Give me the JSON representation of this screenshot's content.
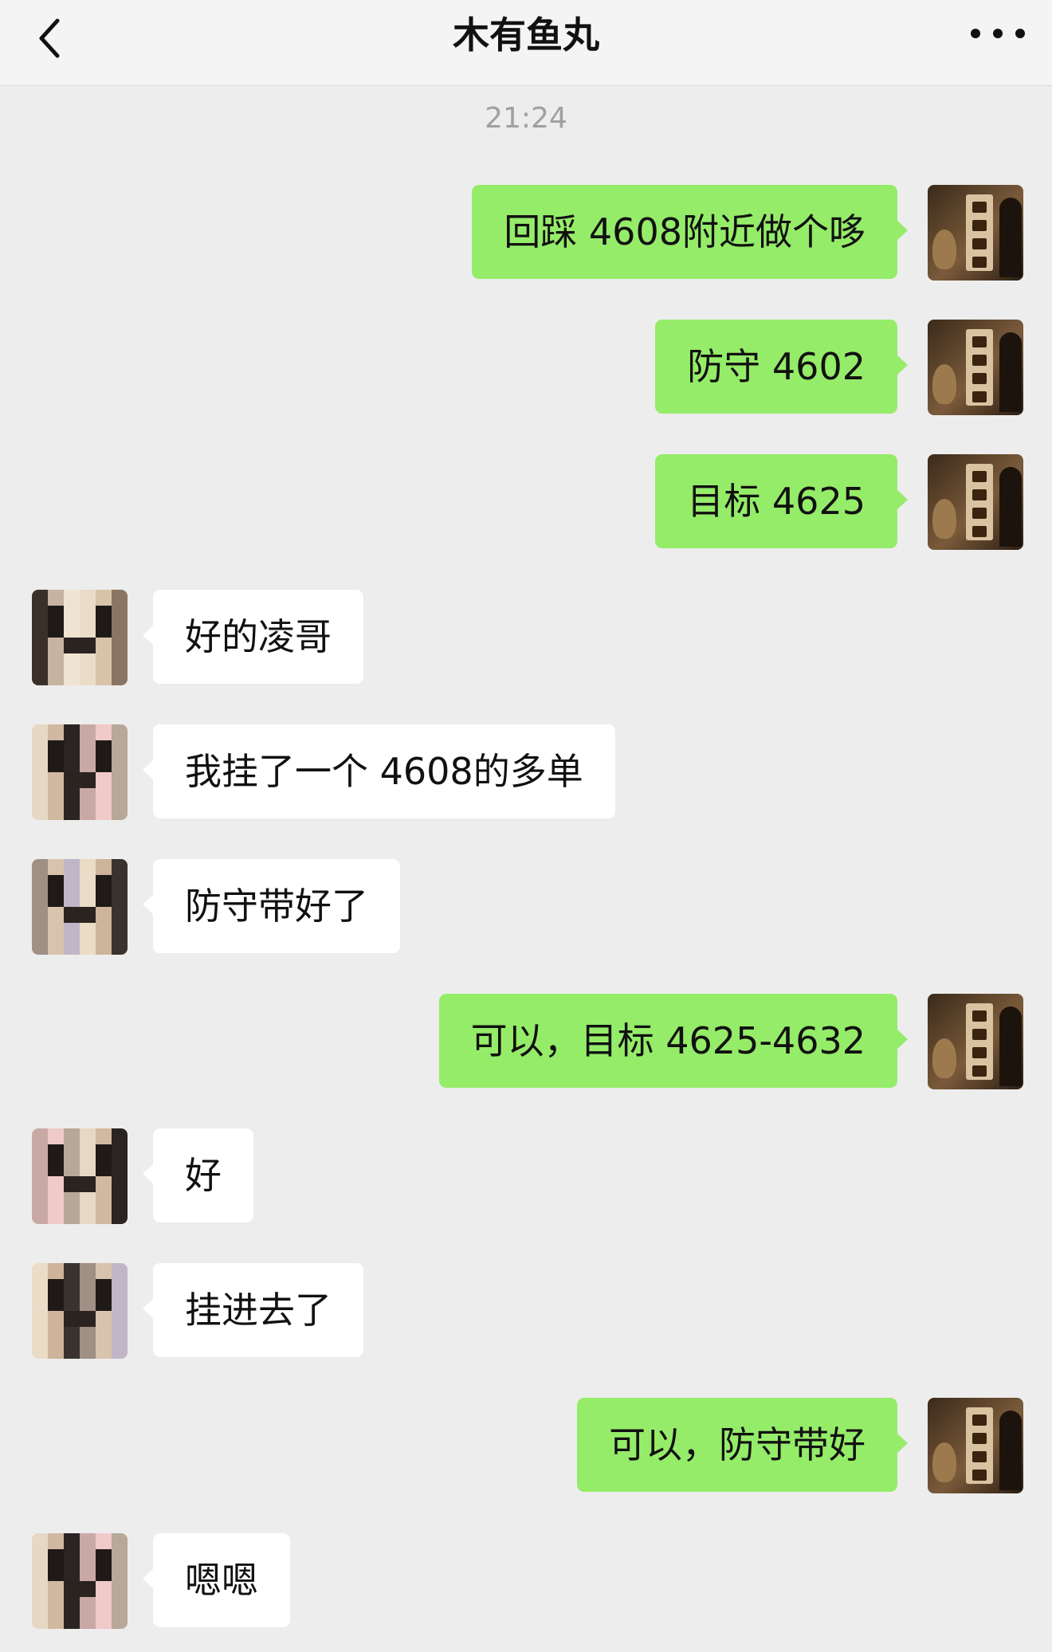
{
  "header": {
    "title": "木有鱼丸"
  },
  "timestamp": "21:24",
  "messages": [
    {
      "side": "sent",
      "text": "回踩 4608附近做个哆"
    },
    {
      "side": "sent",
      "text": "防守 4602"
    },
    {
      "side": "sent",
      "text": "目标 4625"
    },
    {
      "side": "recv",
      "text": "好的凌哥"
    },
    {
      "side": "recv",
      "text": "我挂了一个 4608的多单"
    },
    {
      "side": "recv",
      "text": "防守带好了"
    },
    {
      "side": "sent",
      "text": "可以，目标 4625-4632"
    },
    {
      "side": "recv",
      "text": "好"
    },
    {
      "side": "recv",
      "text": "挂进去了"
    },
    {
      "side": "sent",
      "text": "可以，防守带好"
    },
    {
      "side": "recv",
      "text": "嗯嗯"
    }
  ],
  "icons": {
    "back": "chevron-left-icon",
    "more": "more-dots-icon"
  },
  "colors": {
    "sent_bubble": "#95ec69",
    "recv_bubble": "#ffffff",
    "background": "#ededed"
  }
}
